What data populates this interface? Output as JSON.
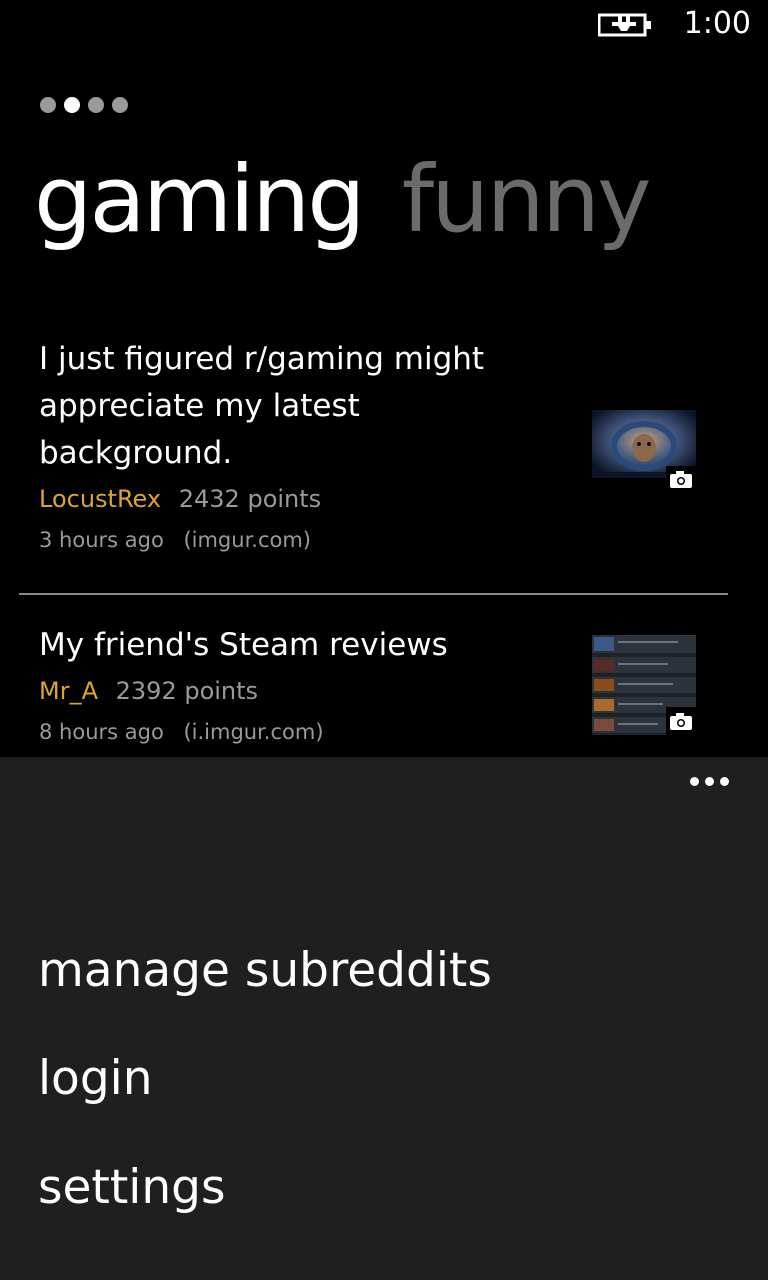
{
  "status_bar": {
    "battery_icon": "battery-charging-icon",
    "time": "1:00"
  },
  "pivot": {
    "dots": 4,
    "active_dot": 1,
    "headers": [
      "gaming",
      "funny"
    ]
  },
  "posts": [
    {
      "title_lines": [
        "I just figured r/gaming might",
        "appreciate my latest",
        "background."
      ],
      "author": "LocustRex",
      "points": "2432 points",
      "time": "3 hours ago",
      "domain": "(imgur.com)",
      "thumbnail_icon": "camera-icon"
    },
    {
      "title_lines": [
        "My friend's Steam reviews"
      ],
      "author": "Mr_A",
      "points": "2392 points",
      "time": "8 hours ago",
      "domain": "(i.imgur.com)",
      "thumbnail_icon": "camera-icon"
    }
  ],
  "app_bar": {
    "more_icon": "ellipsis-icon",
    "menu_items": [
      "manage subreddits",
      "login",
      "settings"
    ]
  },
  "colors": {
    "accent": "#dba62a",
    "background": "#000000",
    "app_bar": "#1f1f1f",
    "secondary_text": "#9a9a9a",
    "inactive_header": "#6b6b6b"
  }
}
